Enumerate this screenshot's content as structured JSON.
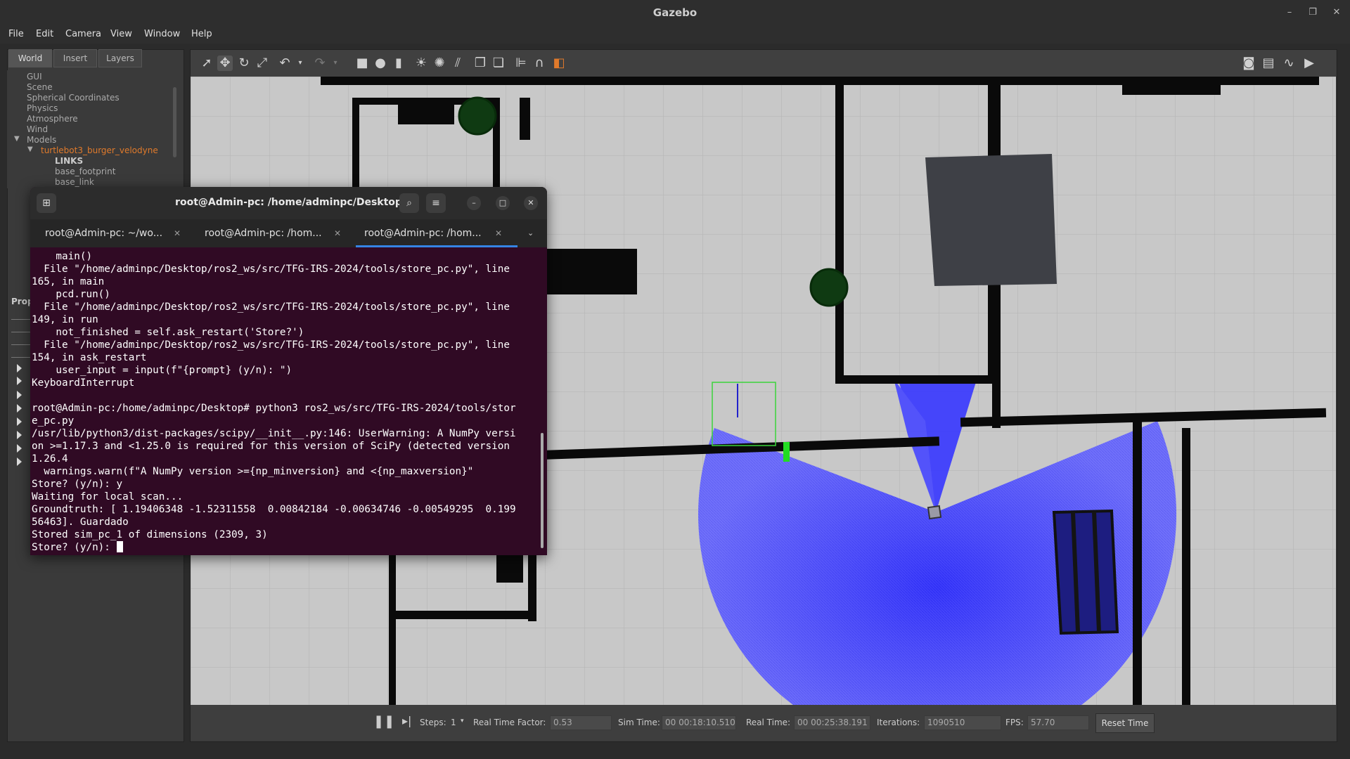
{
  "window": {
    "title": "Gazebo"
  },
  "menu": [
    "File",
    "Edit",
    "Camera",
    "View",
    "Window",
    "Help"
  ],
  "left_tabs": [
    "World",
    "Insert",
    "Layers"
  ],
  "tree": {
    "items": [
      "GUI",
      "Scene",
      "Spherical Coordinates",
      "Physics",
      "Atmosphere",
      "Wind",
      "Models"
    ],
    "model": "turtlebot3_burger_velodyne",
    "links_header": "LINKS",
    "links": [
      "base_footprint",
      "base_link"
    ]
  },
  "props_label": "Prop",
  "terminal": {
    "title": "root@Admin-pc: /home/adminpc/Desktop",
    "tabs": [
      "root@Admin-pc: ~/wo...",
      "root@Admin-pc: /hom...",
      "root@Admin-pc: /hom..."
    ],
    "lines": [
      "    main()",
      "  File \"/home/adminpc/Desktop/ros2_ws/src/TFG-IRS-2024/tools/store_pc.py\", line",
      "165, in main",
      "    pcd.run()",
      "  File \"/home/adminpc/Desktop/ros2_ws/src/TFG-IRS-2024/tools/store_pc.py\", line",
      "149, in run",
      "    not_finished = self.ask_restart('Store?')",
      "  File \"/home/adminpc/Desktop/ros2_ws/src/TFG-IRS-2024/tools/store_pc.py\", line",
      "154, in ask_restart",
      "    user_input = input(f\"{prompt} (y/n): \")",
      "KeyboardInterrupt",
      "",
      "root@Admin-pc:/home/adminpc/Desktop# python3 ros2_ws/src/TFG-IRS-2024/tools/stor",
      "e_pc.py",
      "/usr/lib/python3/dist-packages/scipy/__init__.py:146: UserWarning: A NumPy versi",
      "on >=1.17.3 and <1.25.0 is required for this version of SciPy (detected version",
      "1.26.4",
      "  warnings.warn(f\"A NumPy version >={np_minversion} and <{np_maxversion}\"",
      "Store? (y/n): y",
      "Waiting for local scan...",
      "Groundtruth: [ 1.19406348 -1.52311558  0.00842184 -0.00634746 -0.00549295  0.199",
      "56463]. Guardado",
      "Stored sim_pc_1 of dimensions (2309, 3)"
    ],
    "prompt": "Store? (y/n): "
  },
  "status": {
    "steps_label": "Steps:",
    "steps_value": "1",
    "rtf_label": "Real Time Factor:",
    "rtf_value": "0.53",
    "sim_label": "Sim Time:",
    "sim_value": "00 00:18:10.510",
    "real_label": "Real Time:",
    "real_value": "00 00:25:38.191",
    "iter_label": "Iterations:",
    "iter_value": "1090510",
    "fps_label": "FPS:",
    "fps_value": "57.70",
    "reset_label": "Reset Time"
  },
  "colors": {
    "laser": "#2b2bff",
    "wall": "#0a0a0a",
    "floor": "#c9c9c9",
    "tab_underline": "#3584e4",
    "terminal_bg": "#300a24"
  }
}
